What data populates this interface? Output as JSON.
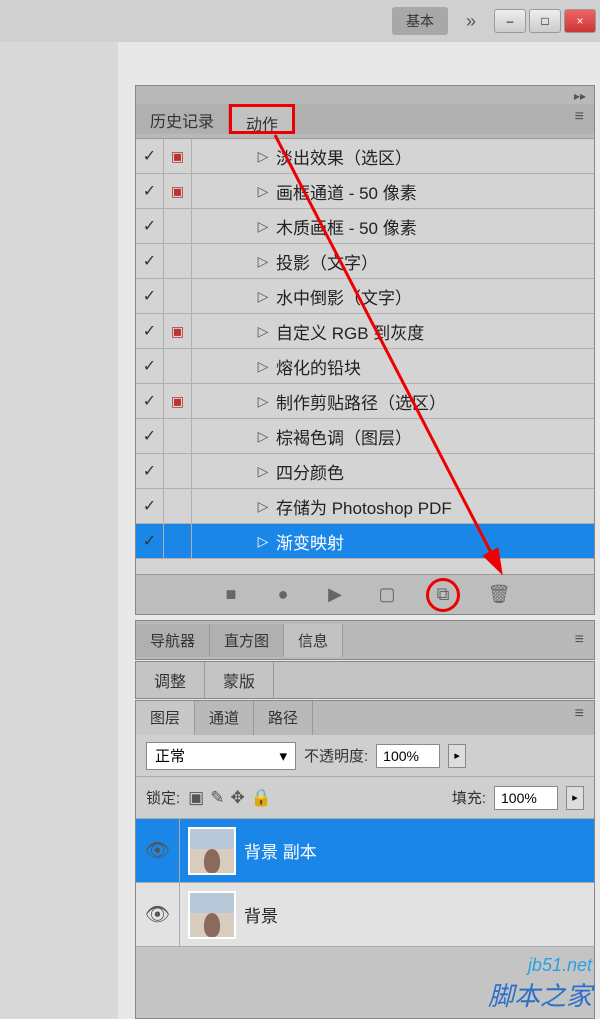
{
  "topbar": {
    "basic": "基本",
    "more": "»",
    "min": "–",
    "max": "□",
    "close": "×"
  },
  "tabs": {
    "history": "历史记录",
    "actions": "动作",
    "navigator": "导航器",
    "histogram": "直方图",
    "info": "信息",
    "adjustments": "调整",
    "masks": "蒙版",
    "layers": "图层",
    "channels": "通道",
    "paths": "路径"
  },
  "actions": [
    {
      "dlg": true,
      "label": "淡出效果（选区）"
    },
    {
      "dlg": true,
      "label": "画框通道 - 50 像素"
    },
    {
      "dlg": false,
      "label": "木质画框 - 50 像素"
    },
    {
      "dlg": false,
      "label": "投影（文字）"
    },
    {
      "dlg": false,
      "label": "水中倒影（文字）"
    },
    {
      "dlg": true,
      "label": "自定义 RGB 到灰度"
    },
    {
      "dlg": false,
      "label": "熔化的铅块"
    },
    {
      "dlg": true,
      "label": "制作剪贴路径（选区）"
    },
    {
      "dlg": false,
      "label": "棕褐色调（图层）"
    },
    {
      "dlg": false,
      "label": "四分颜色"
    },
    {
      "dlg": false,
      "label": "存储为 Photoshop PDF"
    },
    {
      "dlg": false,
      "label": "渐变映射",
      "selected": true
    }
  ],
  "blend": {
    "mode": "正常",
    "opacity_label": "不透明度:",
    "opacity_value": "100%",
    "lock_label": "锁定:",
    "fill_label": "填充:",
    "fill_value": "100%"
  },
  "layers": [
    {
      "name": "背景 副本",
      "selected": true
    },
    {
      "name": "背景",
      "selected": false
    }
  ],
  "icons": {
    "check": "✓",
    "dialog": "▣",
    "expand": "▷",
    "stop": "■",
    "record": "●",
    "play": "▶",
    "folder": "▢",
    "new": "⧉",
    "trash": "🗑",
    "dropdown": "▾",
    "eye": "👁",
    "menu": "≡"
  },
  "watermark": {
    "url": "jb51.net",
    "text": "脚本之家"
  }
}
